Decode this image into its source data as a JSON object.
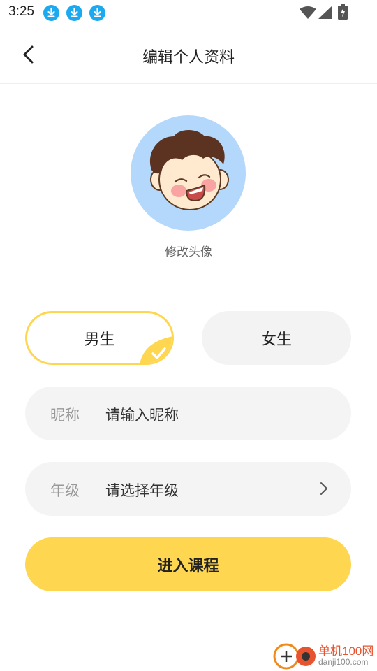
{
  "status_bar": {
    "time": "3:25",
    "notification_icons": [
      "download-icon",
      "download-icon",
      "download-icon"
    ],
    "system_icons": [
      "wifi-icon",
      "signal-icon",
      "battery-charging-icon"
    ],
    "download_icon_color": "#1ba9ef"
  },
  "nav": {
    "title": "编辑个人资料",
    "back_icon": "chevron-left-icon"
  },
  "avatar": {
    "background_color": "#b4d8fb",
    "change_label": "修改头像"
  },
  "gender": {
    "options": [
      {
        "label": "男生",
        "selected": true
      },
      {
        "label": "女生",
        "selected": false
      }
    ],
    "selected_accent": "#ffd650"
  },
  "form": {
    "nickname": {
      "label": "昵称",
      "placeholder": "请输入昵称"
    },
    "grade": {
      "label": "年级",
      "placeholder": "请选择年级",
      "icon": "chevron-right-icon"
    }
  },
  "submit": {
    "label": "进入课程",
    "color": "#ffd650"
  },
  "watermark": {
    "text": "单机100网",
    "url": "danji100.com"
  }
}
